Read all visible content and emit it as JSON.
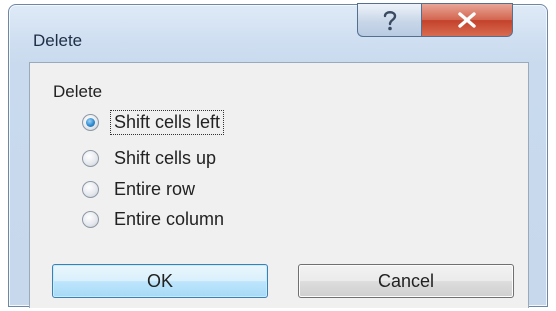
{
  "window": {
    "title": "Delete",
    "help_glyph": "?",
    "close_glyph": "✕"
  },
  "group": {
    "label": "Delete"
  },
  "options": [
    {
      "label": "Shift cells left",
      "checked": true
    },
    {
      "label": "Shift cells up",
      "checked": false
    },
    {
      "label": "Entire row",
      "checked": false
    },
    {
      "label": "Entire column",
      "checked": false
    }
  ],
  "buttons": {
    "ok_label": "OK",
    "cancel_label": "Cancel"
  },
  "colors": {
    "accent": "#2c8ad0",
    "close_red": "#c3412a"
  }
}
